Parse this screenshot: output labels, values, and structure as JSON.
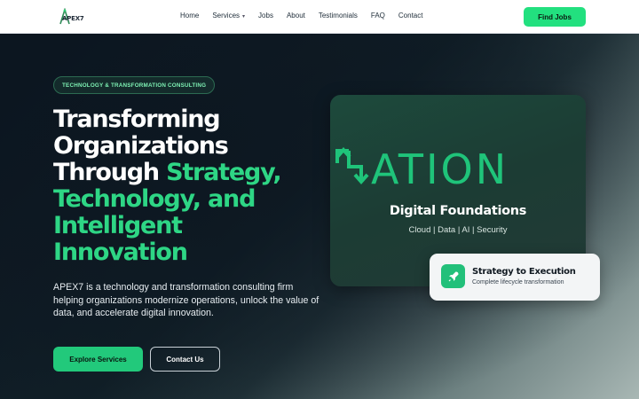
{
  "nav": {
    "logo_text": "APEX7",
    "links": [
      "Home",
      "Services",
      "Jobs",
      "About",
      "Testimonials",
      "FAQ",
      "Contact"
    ],
    "find_jobs": "Find Jobs"
  },
  "hero": {
    "badge": "TECHNOLOGY & TRANSFORMATION CONSULTING",
    "headline_white_1": "Transforming",
    "headline_white_2": "Organizations",
    "headline_white_3": "Through",
    "headline_green_3": "Strategy,",
    "headline_green_4": "Technology, and",
    "headline_green_5": "Intelligent",
    "headline_green_6": "Innovation",
    "description": "APEX7 is a technology and transformation consulting firm helping organizations modernize operations, unlock the value of data, and accelerate digital innovation.",
    "primary_button": "Explore Services",
    "secondary_button": "Contact Us"
  },
  "card": {
    "big_text": "ATION",
    "title": "Digital Foundations",
    "subtitle": "Cloud | Data | AI | Security"
  },
  "mini_card": {
    "title": "Strategy to Execution",
    "subtitle": "Complete lifecycle transformation"
  },
  "colors": {
    "accent": "#22e07f",
    "dark_bg": "#0f1a24"
  },
  "icons": {
    "logo": "apex7-logo-icon",
    "card_arrows": "transform-arrows-icon",
    "mini": "rocket-icon"
  }
}
